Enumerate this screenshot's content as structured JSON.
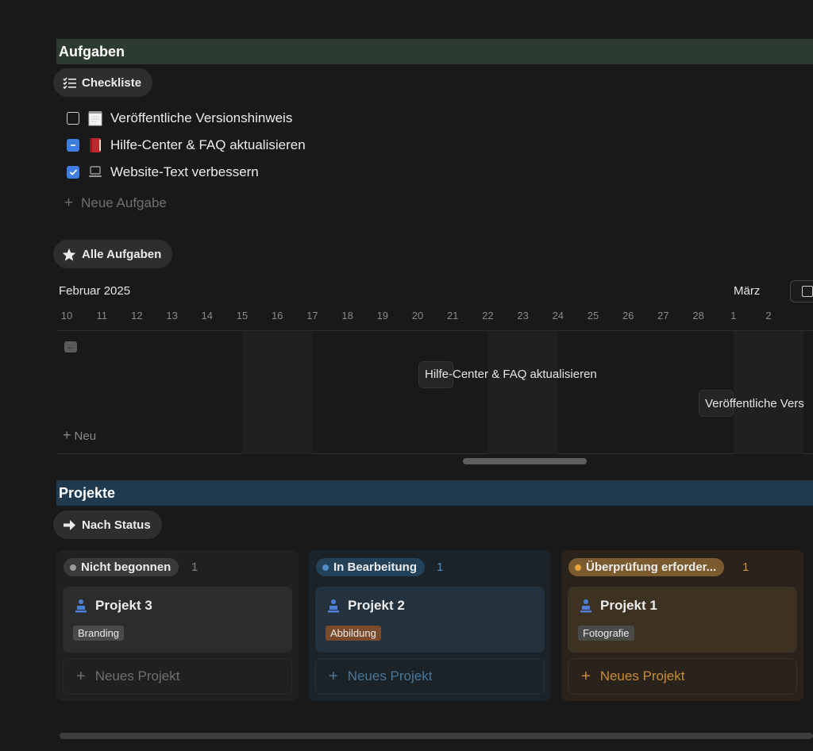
{
  "sections": {
    "aufgaben": "Aufgaben",
    "projekte": "Projekte"
  },
  "views": {
    "checkliste": "Checkliste",
    "alle_aufgaben": "Alle Aufgaben",
    "nach_status": "Nach Status"
  },
  "todos": [
    {
      "label": "Veröffentliche Versionshinweis",
      "state": "unchecked",
      "icon": "notepad-icon"
    },
    {
      "label": "Hilfe-Center & FAQ aktualisieren",
      "state": "partial",
      "icon": "red-book-icon"
    },
    {
      "label": "Website-Text verbessern",
      "state": "checked",
      "icon": "laptop-icon"
    }
  ],
  "new_task_label": "Neue Aufgabe",
  "timeline": {
    "month_feb": "Februar 2025",
    "month_mar": "März",
    "days": [
      "10",
      "11",
      "12",
      "13",
      "14",
      "15",
      "16",
      "17",
      "18",
      "19",
      "20",
      "21",
      "22",
      "23",
      "24",
      "25",
      "26",
      "27",
      "28",
      "1",
      "2"
    ],
    "items": [
      {
        "label": "Hilfe-Center & FAQ aktualisieren"
      },
      {
        "label": "Veröffentliche Vers"
      }
    ],
    "new_label": "Neu"
  },
  "board": {
    "columns": [
      {
        "status": "Nicht begonnen",
        "count": "1",
        "dot_color": "#9b9b9b",
        "badge_bg": "#3a3a3a",
        "count_color": "#7f7f7f",
        "card": {
          "title": "Projekt 3",
          "tag": "Branding",
          "tag_bg": "#4a4a4a",
          "card_bg": "#2c2c2c"
        },
        "new_label": "Neues Projekt",
        "new_color": "#6f6f6f",
        "new_border": "#2c2c2c"
      },
      {
        "status": "In Bearbeitung",
        "count": "1",
        "dot_color": "#4d8dc7",
        "badge_bg": "#234159",
        "count_color": "#4d8dc7",
        "card": {
          "title": "Projekt 2",
          "tag": "Abbildung",
          "tag_bg": "#7a4a2a",
          "card_bg": "#23323d"
        },
        "new_label": "Neues Projekt",
        "new_color": "#4a7697",
        "new_border": "#24313a"
      },
      {
        "status": "Überprüfung erforder...",
        "count": "1",
        "dot_color": "#e6a13a",
        "badge_bg": "#7a5a2e",
        "count_color": "#d0902d",
        "card": {
          "title": "Projekt 1",
          "tag": "Fotografie",
          "tag_bg": "#4a4a4a",
          "card_bg": "#3d3222"
        },
        "new_label": "Neues Projekt",
        "new_color": "#c98b36",
        "new_border": "#3c3122"
      }
    ]
  }
}
